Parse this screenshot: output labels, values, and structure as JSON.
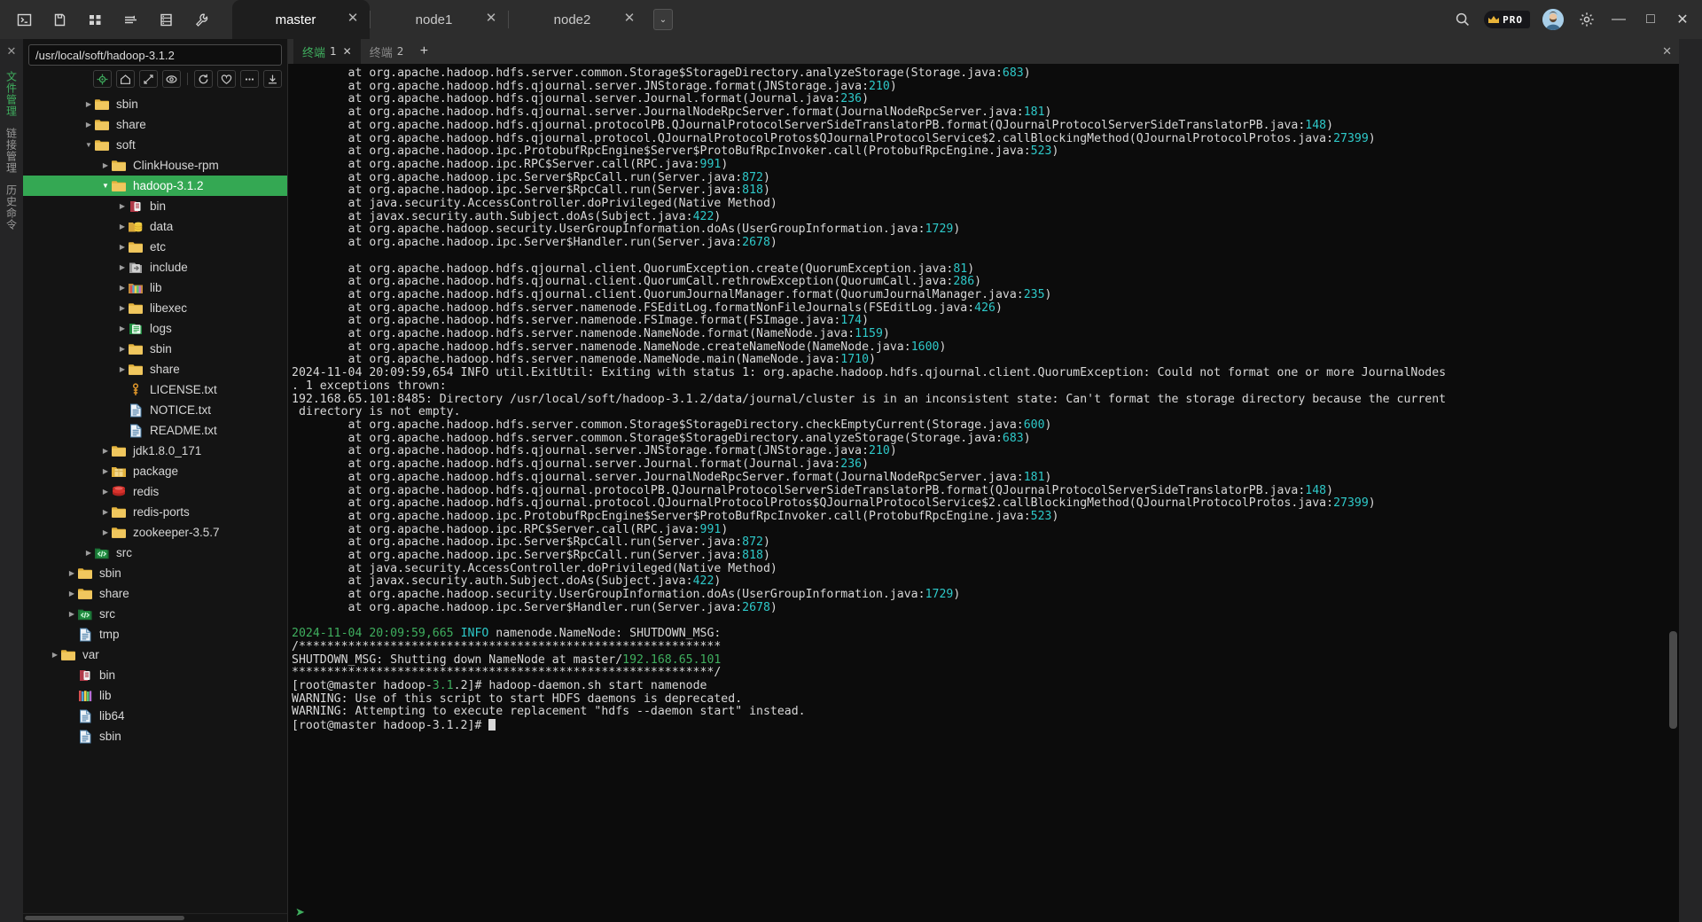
{
  "titlebar": {
    "tools": [
      {
        "name": "terminal-icon",
        "title": "Terminal"
      },
      {
        "name": "file-icon",
        "title": "File"
      },
      {
        "name": "grid-icon",
        "title": "Layout"
      },
      {
        "name": "split-icon",
        "title": "Split"
      },
      {
        "name": "server-icon",
        "title": "Hosts"
      },
      {
        "name": "wrench-icon",
        "title": "Tools"
      }
    ],
    "tabs": [
      {
        "label": "master",
        "active": true,
        "close": "✕"
      },
      {
        "label": "node1",
        "active": false,
        "close": "✕"
      },
      {
        "label": "node2",
        "active": false,
        "close": "✕"
      }
    ],
    "more_label": "⌄",
    "pro_label": "PRO",
    "window": {
      "minimize": "—",
      "maximize": "□",
      "close": "✕"
    }
  },
  "vrail": {
    "close": "✕",
    "labels": [
      {
        "text": "文件管理",
        "color": "green"
      },
      {
        "text": "链接管理",
        "color": "grey"
      },
      {
        "text": "历史命令",
        "color": "grey"
      }
    ]
  },
  "filepanel": {
    "path": "/usr/local/soft/hadoop-3.1.2",
    "path_placeholder": "/",
    "tools": [
      {
        "name": "locate-icon",
        "accent": true
      },
      {
        "name": "home-icon",
        "accent": false
      },
      {
        "name": "collapse-icon",
        "accent": false
      },
      {
        "name": "hidden-files-icon",
        "accent": false
      },
      {
        "divider": true
      },
      {
        "name": "refresh-icon",
        "accent": false
      },
      {
        "name": "favorite-icon",
        "accent": false
      },
      {
        "name": "more-icon",
        "accent": false
      },
      {
        "name": "download-icon",
        "accent": false
      }
    ],
    "tree": [
      {
        "label": "sbin",
        "depth": 1,
        "icon": "folder",
        "arrow": "right",
        "selected": false
      },
      {
        "label": "share",
        "depth": 1,
        "icon": "folder",
        "arrow": "right",
        "selected": false
      },
      {
        "label": "soft",
        "depth": 1,
        "icon": "folder",
        "arrow": "down",
        "selected": false
      },
      {
        "label": "ClinkHouse-rpm",
        "depth": 2,
        "icon": "folder",
        "arrow": "right",
        "selected": false
      },
      {
        "label": "hadoop-3.1.2",
        "depth": 2,
        "icon": "folder",
        "arrow": "down",
        "selected": true
      },
      {
        "label": "bin",
        "depth": 3,
        "icon": "bin",
        "arrow": "right",
        "selected": false
      },
      {
        "label": "data",
        "depth": 3,
        "icon": "data",
        "arrow": "right",
        "selected": false
      },
      {
        "label": "etc",
        "depth": 3,
        "icon": "folder",
        "arrow": "right",
        "selected": false
      },
      {
        "label": "include",
        "depth": 3,
        "icon": "include",
        "arrow": "right",
        "selected": false
      },
      {
        "label": "lib",
        "depth": 3,
        "icon": "lib",
        "arrow": "right",
        "selected": false
      },
      {
        "label": "libexec",
        "depth": 3,
        "icon": "folder",
        "arrow": "right",
        "selected": false
      },
      {
        "label": "logs",
        "depth": 3,
        "icon": "logs",
        "arrow": "right",
        "selected": false
      },
      {
        "label": "sbin",
        "depth": 3,
        "icon": "folder",
        "arrow": "right",
        "selected": false
      },
      {
        "label": "share",
        "depth": 3,
        "icon": "folder",
        "arrow": "right",
        "selected": false
      },
      {
        "label": "LICENSE.txt",
        "depth": 3,
        "icon": "license",
        "arrow": "none",
        "selected": false
      },
      {
        "label": "NOTICE.txt",
        "depth": 3,
        "icon": "textfile",
        "arrow": "none",
        "selected": false
      },
      {
        "label": "README.txt",
        "depth": 3,
        "icon": "textfile",
        "arrow": "none",
        "selected": false
      },
      {
        "label": "jdk1.8.0_171",
        "depth": 2,
        "icon": "folder",
        "arrow": "right",
        "selected": false
      },
      {
        "label": "package",
        "depth": 2,
        "icon": "package",
        "arrow": "right",
        "selected": false
      },
      {
        "label": "redis",
        "depth": 2,
        "icon": "redis",
        "arrow": "right",
        "selected": false
      },
      {
        "label": "redis-ports",
        "depth": 2,
        "icon": "folder",
        "arrow": "right",
        "selected": false
      },
      {
        "label": "zookeeper-3.5.7",
        "depth": 2,
        "icon": "folder",
        "arrow": "right",
        "selected": false
      },
      {
        "label": "src",
        "depth": 1,
        "icon": "src",
        "arrow": "right",
        "selected": false
      },
      {
        "label": "sbin",
        "depth": 0,
        "icon": "folder",
        "arrow": "right",
        "selected": false
      },
      {
        "label": "share",
        "depth": 0,
        "icon": "folder",
        "arrow": "right",
        "selected": false
      },
      {
        "label": "src",
        "depth": 0,
        "icon": "src",
        "arrow": "right",
        "selected": false
      },
      {
        "label": "tmp",
        "depth": 0,
        "icon": "textfile",
        "arrow": "none",
        "selected": false
      },
      {
        "label": "var",
        "depth": -1,
        "icon": "folder",
        "arrow": "right",
        "selected": false
      },
      {
        "label": "bin",
        "depth": 0,
        "icon": "bin",
        "arrow": "none",
        "selected": false
      },
      {
        "label": "lib",
        "depth": 0,
        "icon": "lib2",
        "arrow": "none",
        "selected": false
      },
      {
        "label": "lib64",
        "depth": 0,
        "icon": "textfile",
        "arrow": "none",
        "selected": false
      },
      {
        "label": "sbin",
        "depth": 0,
        "icon": "textfile",
        "arrow": "none",
        "selected": false
      }
    ]
  },
  "terminal": {
    "tabs": [
      {
        "label": "终端",
        "num": "1",
        "active": true,
        "close": "✕"
      },
      {
        "label": "终端",
        "num": "2",
        "active": false,
        "close": ""
      }
    ],
    "add_label": "+",
    "panel_close": "✕",
    "status_icon": "➤",
    "lines": [
      [
        {
          "t": "        at org.apache.hadoop.hdfs.server.common.Storage$StorageDirectory.analyzeStorage(Storage.java:",
          "c": "wht"
        },
        {
          "t": "683",
          "c": "num"
        },
        {
          "t": ")",
          "c": "wht"
        }
      ],
      [
        {
          "t": "        at org.apache.hadoop.hdfs.qjournal.server.JNStorage.format(JNStorage.java:",
          "c": "wht"
        },
        {
          "t": "210",
          "c": "num"
        },
        {
          "t": ")",
          "c": "wht"
        }
      ],
      [
        {
          "t": "        at org.apache.hadoop.hdfs.qjournal.server.Journal.format(Journal.java:",
          "c": "wht"
        },
        {
          "t": "236",
          "c": "num"
        },
        {
          "t": ")",
          "c": "wht"
        }
      ],
      [
        {
          "t": "        at org.apache.hadoop.hdfs.qjournal.server.JournalNodeRpcServer.format(JournalNodeRpcServer.java:",
          "c": "wht"
        },
        {
          "t": "181",
          "c": "num"
        },
        {
          "t": ")",
          "c": "wht"
        }
      ],
      [
        {
          "t": "        at org.apache.hadoop.hdfs.qjournal.protocolPB.QJournalProtocolServerSideTranslatorPB.format(QJournalProtocolServerSideTranslatorPB.java:",
          "c": "wht"
        },
        {
          "t": "148",
          "c": "num"
        },
        {
          "t": ")",
          "c": "wht"
        }
      ],
      [
        {
          "t": "        at org.apache.hadoop.hdfs.qjournal.protocol.QJournalProtocolProtos$QJournalProtocolService$2.callBlockingMethod(QJournalProtocolProtos.java:",
          "c": "wht"
        },
        {
          "t": "27399",
          "c": "num"
        },
        {
          "t": ")",
          "c": "wht"
        }
      ],
      [
        {
          "t": "        at org.apache.hadoop.ipc.ProtobufRpcEngine$Server$ProtoBufRpcInvoker.call(ProtobufRpcEngine.java:",
          "c": "wht"
        },
        {
          "t": "523",
          "c": "num"
        },
        {
          "t": ")",
          "c": "wht"
        }
      ],
      [
        {
          "t": "        at org.apache.hadoop.ipc.RPC$Server.call(RPC.java:",
          "c": "wht"
        },
        {
          "t": "991",
          "c": "num"
        },
        {
          "t": ")",
          "c": "wht"
        }
      ],
      [
        {
          "t": "        at org.apache.hadoop.ipc.Server$RpcCall.run(Server.java:",
          "c": "wht"
        },
        {
          "t": "872",
          "c": "num"
        },
        {
          "t": ")",
          "c": "wht"
        }
      ],
      [
        {
          "t": "        at org.apache.hadoop.ipc.Server$RpcCall.run(Server.java:",
          "c": "wht"
        },
        {
          "t": "818",
          "c": "num"
        },
        {
          "t": ")",
          "c": "wht"
        }
      ],
      [
        {
          "t": "        at java.security.AccessController.doPrivileged(Native Method)",
          "c": "wht"
        }
      ],
      [
        {
          "t": "        at javax.security.auth.Subject.doAs(Subject.java:",
          "c": "wht"
        },
        {
          "t": "422",
          "c": "num"
        },
        {
          "t": ")",
          "c": "wht"
        }
      ],
      [
        {
          "t": "        at org.apache.hadoop.security.UserGroupInformation.doAs(UserGroupInformation.java:",
          "c": "wht"
        },
        {
          "t": "1729",
          "c": "num"
        },
        {
          "t": ")",
          "c": "wht"
        }
      ],
      [
        {
          "t": "        at org.apache.hadoop.ipc.Server$Handler.run(Server.java:",
          "c": "wht"
        },
        {
          "t": "2678",
          "c": "num"
        },
        {
          "t": ")",
          "c": "wht"
        }
      ],
      [
        {
          "t": "",
          "c": "wht"
        }
      ],
      [
        {
          "t": "        at org.apache.hadoop.hdfs.qjournal.client.QuorumException.create(QuorumException.java:",
          "c": "wht"
        },
        {
          "t": "81",
          "c": "num"
        },
        {
          "t": ")",
          "c": "wht"
        }
      ],
      [
        {
          "t": "        at org.apache.hadoop.hdfs.qjournal.client.QuorumCall.rethrowException(QuorumCall.java:",
          "c": "wht"
        },
        {
          "t": "286",
          "c": "num"
        },
        {
          "t": ")",
          "c": "wht"
        }
      ],
      [
        {
          "t": "        at org.apache.hadoop.hdfs.qjournal.client.QuorumJournalManager.format(QuorumJournalManager.java:",
          "c": "wht"
        },
        {
          "t": "235",
          "c": "num"
        },
        {
          "t": ")",
          "c": "wht"
        }
      ],
      [
        {
          "t": "        at org.apache.hadoop.hdfs.server.namenode.FSEditLog.formatNonFileJournals(FSEditLog.java:",
          "c": "wht"
        },
        {
          "t": "426",
          "c": "num"
        },
        {
          "t": ")",
          "c": "wht"
        }
      ],
      [
        {
          "t": "        at org.apache.hadoop.hdfs.server.namenode.FSImage.format(FSImage.java:",
          "c": "wht"
        },
        {
          "t": "174",
          "c": "num"
        },
        {
          "t": ")",
          "c": "wht"
        }
      ],
      [
        {
          "t": "        at org.apache.hadoop.hdfs.server.namenode.NameNode.format(NameNode.java:",
          "c": "wht"
        },
        {
          "t": "1159",
          "c": "num"
        },
        {
          "t": ")",
          "c": "wht"
        }
      ],
      [
        {
          "t": "        at org.apache.hadoop.hdfs.server.namenode.NameNode.createNameNode(NameNode.java:",
          "c": "wht"
        },
        {
          "t": "1600",
          "c": "num"
        },
        {
          "t": ")",
          "c": "wht"
        }
      ],
      [
        {
          "t": "        at org.apache.hadoop.hdfs.server.namenode.NameNode.main(NameNode.java:",
          "c": "wht"
        },
        {
          "t": "1710",
          "c": "num"
        },
        {
          "t": ")",
          "c": "wht"
        }
      ],
      [
        {
          "t": "2024-11-04 20:09:59,654 INFO util.ExitUtil: Exiting with status 1: org.apache.hadoop.hdfs.qjournal.client.QuorumException: Could not format one or more JournalNodes",
          "c": "wht"
        }
      ],
      [
        {
          "t": ". 1 exceptions thrown:",
          "c": "wht"
        }
      ],
      [
        {
          "t": "192.168.65.101:8485: Directory /usr/local/soft/hadoop-3.1.2/data/journal/cluster is in an inconsistent state: Can't format the storage directory because the current",
          "c": "wht"
        }
      ],
      [
        {
          "t": " directory is not empty.",
          "c": "wht"
        }
      ],
      [
        {
          "t": "        at org.apache.hadoop.hdfs.server.common.Storage$StorageDirectory.checkEmptyCurrent(Storage.java:",
          "c": "wht"
        },
        {
          "t": "600",
          "c": "num"
        },
        {
          "t": ")",
          "c": "wht"
        }
      ],
      [
        {
          "t": "        at org.apache.hadoop.hdfs.server.common.Storage$StorageDirectory.analyzeStorage(Storage.java:",
          "c": "wht"
        },
        {
          "t": "683",
          "c": "num"
        },
        {
          "t": ")",
          "c": "wht"
        }
      ],
      [
        {
          "t": "        at org.apache.hadoop.hdfs.qjournal.server.JNStorage.format(JNStorage.java:",
          "c": "wht"
        },
        {
          "t": "210",
          "c": "num"
        },
        {
          "t": ")",
          "c": "wht"
        }
      ],
      [
        {
          "t": "        at org.apache.hadoop.hdfs.qjournal.server.Journal.format(Journal.java:",
          "c": "wht"
        },
        {
          "t": "236",
          "c": "num"
        },
        {
          "t": ")",
          "c": "wht"
        }
      ],
      [
        {
          "t": "        at org.apache.hadoop.hdfs.qjournal.server.JournalNodeRpcServer.format(JournalNodeRpcServer.java:",
          "c": "wht"
        },
        {
          "t": "181",
          "c": "num"
        },
        {
          "t": ")",
          "c": "wht"
        }
      ],
      [
        {
          "t": "        at org.apache.hadoop.hdfs.qjournal.protocolPB.QJournalProtocolServerSideTranslatorPB.format(QJournalProtocolServerSideTranslatorPB.java:",
          "c": "wht"
        },
        {
          "t": "148",
          "c": "num"
        },
        {
          "t": ")",
          "c": "wht"
        }
      ],
      [
        {
          "t": "        at org.apache.hadoop.hdfs.qjournal.protocol.QJournalProtocolProtos$QJournalProtocolService$2.callBlockingMethod(QJournalProtocolProtos.java:",
          "c": "wht"
        },
        {
          "t": "27399",
          "c": "num"
        },
        {
          "t": ")",
          "c": "wht"
        }
      ],
      [
        {
          "t": "        at org.apache.hadoop.ipc.ProtobufRpcEngine$Server$ProtoBufRpcInvoker.call(ProtobufRpcEngine.java:",
          "c": "wht"
        },
        {
          "t": "523",
          "c": "num"
        },
        {
          "t": ")",
          "c": "wht"
        }
      ],
      [
        {
          "t": "        at org.apache.hadoop.ipc.RPC$Server.call(RPC.java:",
          "c": "wht"
        },
        {
          "t": "991",
          "c": "num"
        },
        {
          "t": ")",
          "c": "wht"
        }
      ],
      [
        {
          "t": "        at org.apache.hadoop.ipc.Server$RpcCall.run(Server.java:",
          "c": "wht"
        },
        {
          "t": "872",
          "c": "num"
        },
        {
          "t": ")",
          "c": "wht"
        }
      ],
      [
        {
          "t": "        at org.apache.hadoop.ipc.Server$RpcCall.run(Server.java:",
          "c": "wht"
        },
        {
          "t": "818",
          "c": "num"
        },
        {
          "t": ")",
          "c": "wht"
        }
      ],
      [
        {
          "t": "        at java.security.AccessController.doPrivileged(Native Method)",
          "c": "wht"
        }
      ],
      [
        {
          "t": "        at javax.security.auth.Subject.doAs(Subject.java:",
          "c": "wht"
        },
        {
          "t": "422",
          "c": "num"
        },
        {
          "t": ")",
          "c": "wht"
        }
      ],
      [
        {
          "t": "        at org.apache.hadoop.security.UserGroupInformation.doAs(UserGroupInformation.java:",
          "c": "wht"
        },
        {
          "t": "1729",
          "c": "num"
        },
        {
          "t": ")",
          "c": "wht"
        }
      ],
      [
        {
          "t": "        at org.apache.hadoop.ipc.Server$Handler.run(Server.java:",
          "c": "wht"
        },
        {
          "t": "2678",
          "c": "num"
        },
        {
          "t": ")",
          "c": "wht"
        }
      ],
      [
        {
          "t": "",
          "c": "wht"
        }
      ],
      [
        {
          "t": "2024-11-04 20:09:59,665",
          "c": "grn"
        },
        {
          "t": " ",
          "c": "wht"
        },
        {
          "t": "INFO",
          "c": "cyn"
        },
        {
          "t": " namenode.NameNode: SHUTDOWN_MSG:",
          "c": "wht"
        }
      ],
      [
        {
          "t": "/************************************************************",
          "c": "wht"
        }
      ],
      [
        {
          "t": "SHUTDOWN_MSG: Shutting down NameNode at master/",
          "c": "wht"
        },
        {
          "t": "192.168.65.101",
          "c": "grn"
        }
      ],
      [
        {
          "t": "************************************************************/",
          "c": "wht"
        }
      ],
      [
        {
          "t": "[root@master hadoop-",
          "c": "wht"
        },
        {
          "t": "3.1",
          "c": "grn"
        },
        {
          "t": ".2]# hadoop-daemon.sh start namenode",
          "c": "wht"
        }
      ],
      [
        {
          "t": "WARNING: Use of this script to start HDFS daemons is deprecated.",
          "c": "wht"
        }
      ],
      [
        {
          "t": "WARNING: Attempting to execute replacement \"hdfs --daemon start\" instead.",
          "c": "wht"
        }
      ],
      [
        {
          "t": "[root@master hadoop-3.1.2]# ",
          "c": "wht",
          "cursor": true
        }
      ]
    ]
  }
}
